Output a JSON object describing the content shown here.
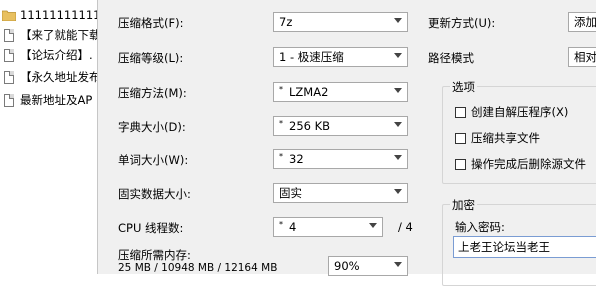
{
  "tree": {
    "items": [
      {
        "label": "11111111111",
        "icon": "folder-icon"
      },
      {
        "label": "【来了就能下载",
        "icon": "document-icon"
      },
      {
        "label": "【论坛介绍】.",
        "icon": "document-icon"
      },
      {
        "label": "【永久地址发布",
        "icon": "document-icon"
      },
      {
        "label": "最新地址及AP",
        "icon": "document-icon"
      }
    ]
  },
  "dialog": {
    "format": {
      "label": "压缩格式(F):",
      "value": "7z"
    },
    "level": {
      "label": "压缩等级(L):",
      "value": "1 - 极速压缩"
    },
    "method": {
      "label": "压缩方法(M):",
      "value": "LZMA2"
    },
    "dict": {
      "label": "字典大小(D):",
      "value": "256 KB"
    },
    "word": {
      "label": "单词大小(W):",
      "value": "32"
    },
    "solid": {
      "label": "固实数据大小:",
      "value": "固实"
    },
    "threads": {
      "label": "CPU 线程数:",
      "value": "4",
      "max": "/ 4"
    },
    "memory": {
      "label": "压缩所需内存:",
      "values": "25 MB / 10948 MB / 12164 MB",
      "percent": "90%"
    },
    "update": {
      "label": "更新方式(U):",
      "value": "添加"
    },
    "path": {
      "label": "路径模式",
      "value": "相对"
    },
    "options": {
      "title": "选项",
      "items": [
        {
          "label": "创建自解压程序(X)",
          "checked": false
        },
        {
          "label": "压缩共享文件",
          "checked": false
        },
        {
          "label": "操作完成后删除源文件",
          "checked": false
        }
      ]
    },
    "encryption": {
      "title": "加密",
      "password_label": "输入密码:",
      "password_value": "上老王论坛当老王"
    }
  },
  "colors": {
    "dialog_bg": "#f0f0f0",
    "border": "#a8a8a8",
    "folder": "#e8c060"
  }
}
